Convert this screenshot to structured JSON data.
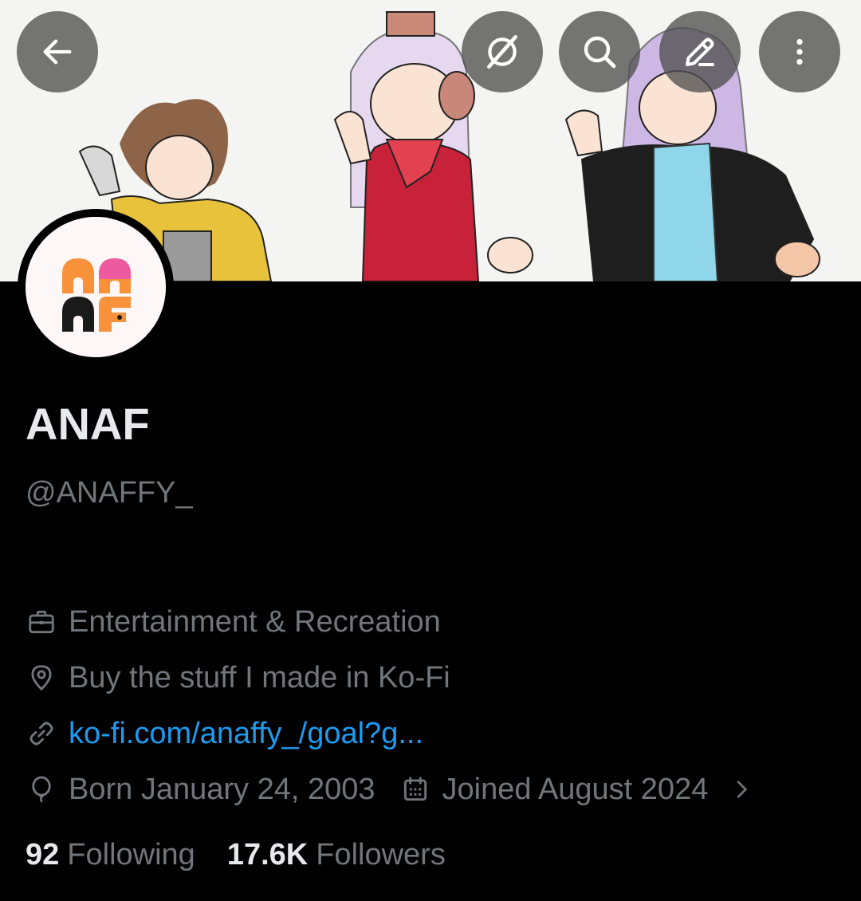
{
  "header": {
    "buttons": [
      {
        "name": "back-button",
        "icon": "arrow-left-icon"
      },
      {
        "name": "grok-button",
        "icon": "grok-slash-icon"
      },
      {
        "name": "search-button",
        "icon": "search-icon"
      },
      {
        "name": "edit-button",
        "icon": "pencil-icon"
      },
      {
        "name": "more-button",
        "icon": "more-vertical-icon"
      }
    ]
  },
  "profile": {
    "display_name": "ANAF",
    "handle": "@ANAFFY_",
    "category": "Entertainment & Recreation",
    "location": "Buy the stuff I made in Ko-Fi",
    "website": "ko-fi.com/anaffy_/goal?g...",
    "birthday": "Born January 24, 2003",
    "joined": "Joined August 2024"
  },
  "stats": {
    "following_count": "92",
    "following_label": "Following",
    "followers_count": "17.6K",
    "followers_label": "Followers"
  },
  "colors": {
    "background": "#000000",
    "primary_text": "#e7e9ea",
    "secondary_text": "#71767b",
    "link": "#1d9bf0",
    "avatar_orange": "#f7923a",
    "avatar_pink": "#ee5aa0"
  }
}
